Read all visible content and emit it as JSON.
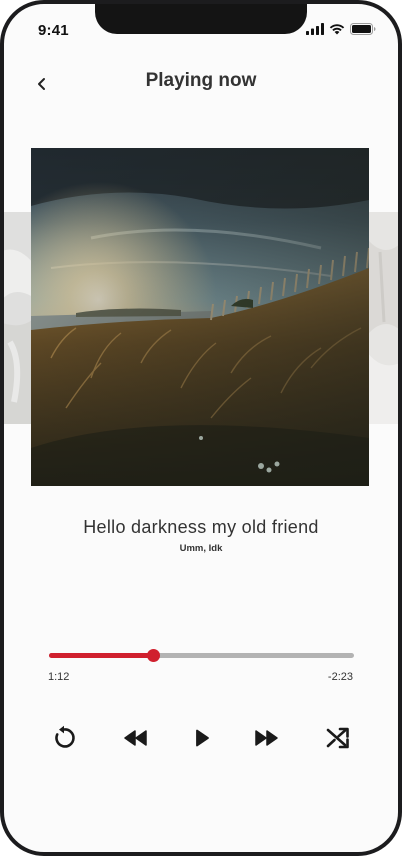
{
  "status_bar": {
    "time": "9:41",
    "icons": [
      "signal-icon",
      "wifi-icon",
      "battery-icon"
    ]
  },
  "header": {
    "back_icon": "chevron-left-icon",
    "title": "Playing now"
  },
  "track": {
    "title": "Hello darkness my old friend",
    "artist": "Umm, Idk"
  },
  "progress": {
    "elapsed": "1:12",
    "remaining": "-2:23",
    "fraction": 0.34
  },
  "controls": {
    "icons": [
      "replay-icon",
      "rewind-icon",
      "play-icon",
      "fast-forward-icon",
      "shuffle-icon"
    ]
  },
  "colors": {
    "accent": "#d0202e",
    "track": "#b3b3b3",
    "text": "#333333",
    "background": "#fbfbfb"
  }
}
